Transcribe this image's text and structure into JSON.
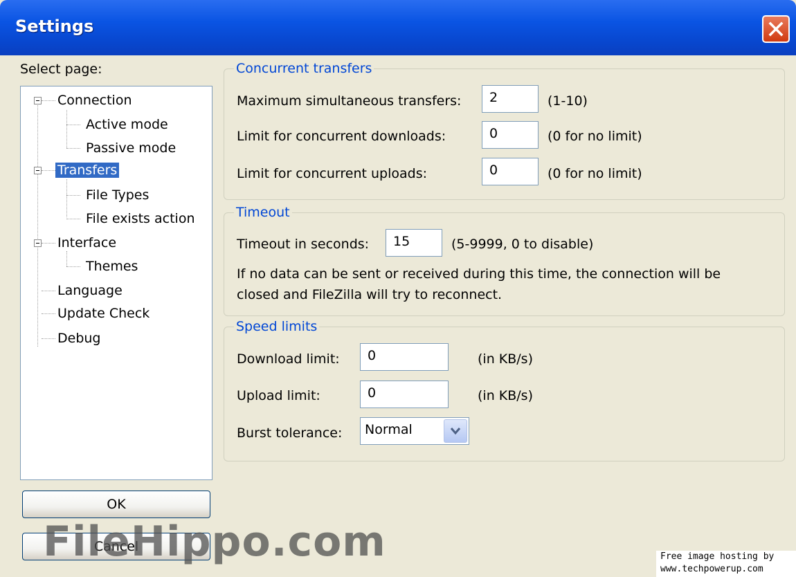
{
  "window": {
    "title": "Settings"
  },
  "sidebar": {
    "select_page_label": "Select page:",
    "items": [
      {
        "label": "Connection"
      },
      {
        "label": "Active mode"
      },
      {
        "label": "Passive mode"
      },
      {
        "label": "Transfers"
      },
      {
        "label": "File Types"
      },
      {
        "label": "File exists action"
      },
      {
        "label": "Interface"
      },
      {
        "label": "Themes"
      },
      {
        "label": "Language"
      },
      {
        "label": "Update Check"
      },
      {
        "label": "Debug"
      }
    ],
    "selected": "Transfers"
  },
  "concurrent": {
    "legend": "Concurrent transfers",
    "max_label": "Maximum simultaneous transfers:",
    "max_value": "2",
    "max_hint": "(1-10)",
    "downloads_label": "Limit for concurrent downloads:",
    "downloads_value": "0",
    "downloads_hint": "(0 for no limit)",
    "uploads_label": "Limit for concurrent uploads:",
    "uploads_value": "0",
    "uploads_hint": "(0 for no limit)"
  },
  "timeout": {
    "legend": "Timeout",
    "label": "Timeout in seconds:",
    "value": "15",
    "hint": "(5-9999, 0 to disable)",
    "desc_line1": "If no data can be sent or received during this time, the connection will be",
    "desc_line2": "closed and FileZilla will try to reconnect."
  },
  "speed": {
    "legend": "Speed limits",
    "download_label": "Download limit:",
    "download_value": "0",
    "download_unit": "(in KB/s)",
    "upload_label": "Upload limit:",
    "upload_value": "0",
    "upload_unit": "(in KB/s)",
    "burst_label": "Burst tolerance:",
    "burst_value": "Normal"
  },
  "buttons": {
    "ok": "OK",
    "cancel": "Cancel"
  },
  "overlay": {
    "watermark": "FileHippo.com",
    "hosting_line1": "Free image hosting by",
    "hosting_line2": "www.techpowerup.com"
  },
  "colors": {
    "titlebar": "#0a54e3",
    "selection": "#316ac5",
    "group_legend": "#0046d5",
    "window_bg": "#ece9d8"
  }
}
